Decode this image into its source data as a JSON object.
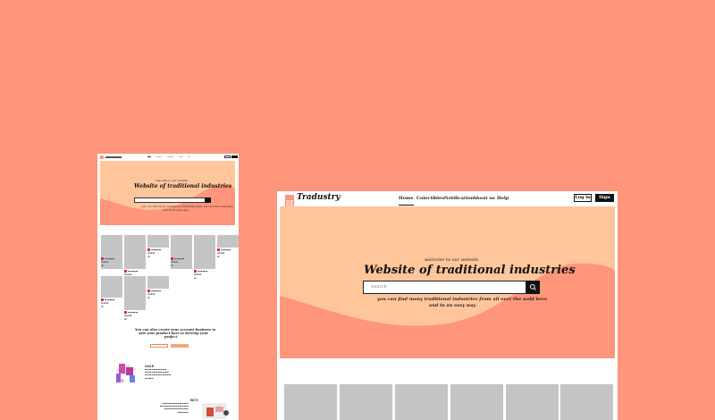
{
  "app": {
    "name": "Tradustry"
  },
  "nav": {
    "items": [
      {
        "label": "Home",
        "active": true
      },
      {
        "label": "Colectibles"
      },
      {
        "label": "Notification"
      },
      {
        "label": "About us"
      },
      {
        "label": "Help"
      }
    ],
    "login_label": "Log in",
    "signup_label": "Sign up"
  },
  "hero": {
    "welcome": "welcome to our website",
    "title": "Website of traditional industries",
    "search_placeholder": "Search",
    "subtitle_line1": "you can find many traditional industries from all over the wold here",
    "subtitle_line2": "and in an easy way"
  },
  "mini": {
    "cta_line1": "You can also create your account business to",
    "cta_line2": "sale your product here to develop your",
    "cta_line3": "project",
    "sale_title": "SALE",
    "buy_title": "BUY"
  },
  "colors": {
    "background": "#ff957a",
    "hero_bg": "#ffc69b",
    "wave": "#ff957a",
    "placeholder_card": "#c4c4c4",
    "dark": "#111111"
  }
}
